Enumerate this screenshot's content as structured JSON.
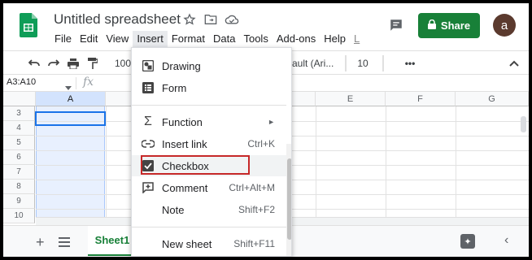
{
  "doc": {
    "title": "Untitled spreadsheet"
  },
  "menubar": [
    "File",
    "Edit",
    "View",
    "Insert",
    "Format",
    "Data",
    "Tools",
    "Add-ons",
    "Help",
    "L"
  ],
  "share": {
    "label": "Share"
  },
  "avatar": {
    "initial": "a"
  },
  "toolbar": {
    "zoom": "100",
    "font": "ault (Ari...",
    "font_size": "10",
    "more": "•••"
  },
  "formula_bar": {
    "name_box": "A3:A10",
    "fx": "fx"
  },
  "grid": {
    "columns": [
      "A",
      "E",
      "F",
      "G"
    ],
    "rows": [
      "3",
      "4",
      "5",
      "6",
      "7",
      "8",
      "9",
      "10"
    ]
  },
  "sheets": {
    "active": "Sheet1"
  },
  "insert_menu": {
    "items": [
      {
        "label": "Drawing",
        "shortcut": "",
        "icon": "drawing-icon"
      },
      {
        "label": "Form",
        "shortcut": "",
        "icon": "form-icon"
      },
      {
        "label": "Function",
        "shortcut": "►",
        "icon": "sigma-icon"
      },
      {
        "label": "Insert link",
        "shortcut": "Ctrl+K",
        "icon": "link-icon"
      },
      {
        "label": "Checkbox",
        "shortcut": "",
        "icon": "checkbox-icon"
      },
      {
        "label": "Comment",
        "shortcut": "Ctrl+Alt+M",
        "icon": "comment-add-icon"
      },
      {
        "label": "Note",
        "shortcut": "Shift+F2",
        "icon": ""
      },
      {
        "label": "New sheet",
        "shortcut": "Shift+F11",
        "icon": ""
      }
    ]
  },
  "colors": {
    "share_green": "#188038",
    "highlight_red": "#c62828",
    "selection_blue": "#1a73e8"
  }
}
